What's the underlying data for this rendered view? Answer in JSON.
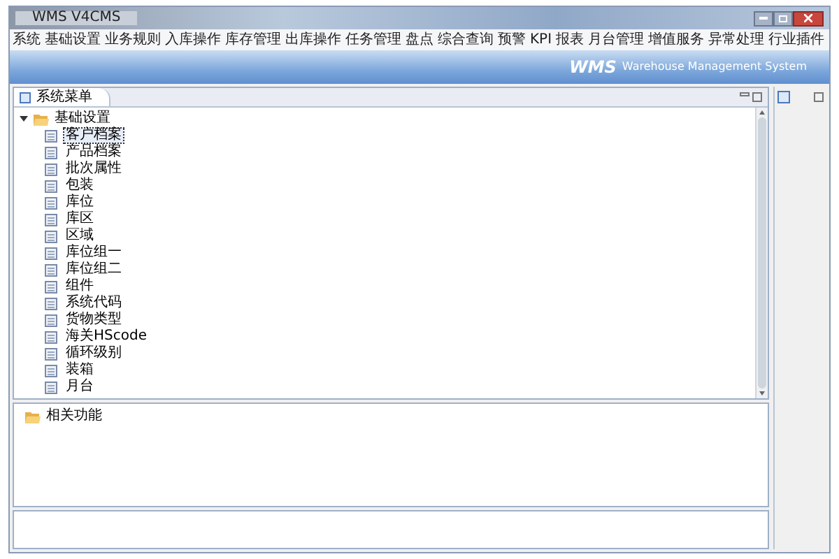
{
  "window": {
    "title": "WMS V4CMS"
  },
  "menu": [
    "系统",
    "基础设置",
    "业务规则",
    "入库操作",
    "库存管理",
    "出库操作",
    "任务管理",
    "盘点",
    "综合查询",
    "预警",
    "KPI",
    "报表",
    "月台管理",
    "增值服务",
    "异常处理",
    "行业插件"
  ],
  "banner": {
    "logo": "WMS",
    "subtitle": "Warehouse Management System"
  },
  "panel_tab": {
    "label": "系统菜单"
  },
  "tree": [
    {
      "label": "基础设置",
      "expanded": true,
      "children": [
        {
          "label": "客户档案",
          "selected": true
        },
        {
          "label": "产品档案",
          "selected": false
        },
        {
          "label": "批次属性",
          "selected": false
        },
        {
          "label": "包装",
          "selected": false
        },
        {
          "label": "库位",
          "selected": false
        },
        {
          "label": "库区",
          "selected": false
        },
        {
          "label": "区域",
          "selected": false
        },
        {
          "label": "库位组一",
          "selected": false
        },
        {
          "label": "库位组二",
          "selected": false
        },
        {
          "label": "组件",
          "selected": false
        },
        {
          "label": "系统代码",
          "selected": false
        },
        {
          "label": "货物类型",
          "selected": false
        },
        {
          "label": "海关HScode",
          "selected": false
        },
        {
          "label": "循环级别",
          "selected": false
        },
        {
          "label": "装箱",
          "selected": false
        },
        {
          "label": "月台",
          "selected": false
        }
      ]
    }
  ],
  "related": {
    "label": "相关功能"
  }
}
